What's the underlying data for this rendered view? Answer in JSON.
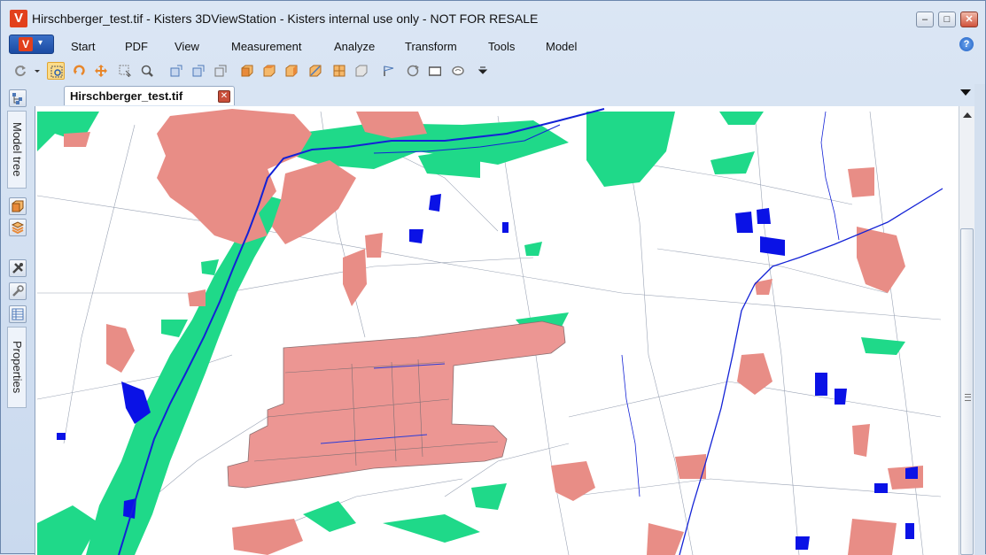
{
  "window": {
    "title": "Hirschberger_test.tif - Kisters 3DViewStation - Kisters internal use only - NOT FOR RESALE",
    "app_logo_letter": "V",
    "minimize_symbol": "–",
    "maximize_symbol": "□",
    "close_symbol": "✕"
  },
  "menu": {
    "app_button_letter": "V",
    "app_button_arrow": "▾",
    "items": [
      "Start",
      "PDF",
      "View",
      "Measurement",
      "Analyze",
      "Transform",
      "Tools",
      "Model"
    ],
    "help_symbol": "?"
  },
  "toolbar": {
    "icons": [
      "refresh-icon",
      "zoom-box-icon",
      "rotate-icon",
      "pan-icon",
      "select-area-icon",
      "zoom-icon",
      "fit-icon",
      "fit-selection-icon",
      "fit-view-icon",
      "view-front-icon",
      "view-top-icon",
      "view-side-icon",
      "view-iso-icon",
      "view-grid-icon",
      "view-back-icon",
      "flag-icon",
      "circle-arrow-icon",
      "rectangle-icon",
      "cloud-icon",
      "more-icon"
    ],
    "active_icon": "zoom-box-icon"
  },
  "left_panel": {
    "model_tree_label": "Model tree",
    "properties_label": "Properties"
  },
  "tabs": {
    "active_tab": "Hirschberger_test.tif",
    "close_symbol": "✕"
  },
  "colors": {
    "settlement": "#e88d86",
    "forest": "#1fd989",
    "water": "#0a12e6",
    "river": "#1322d6",
    "airport": "#ec9693",
    "road": "#8d97a8",
    "accent": "#e2401c"
  }
}
